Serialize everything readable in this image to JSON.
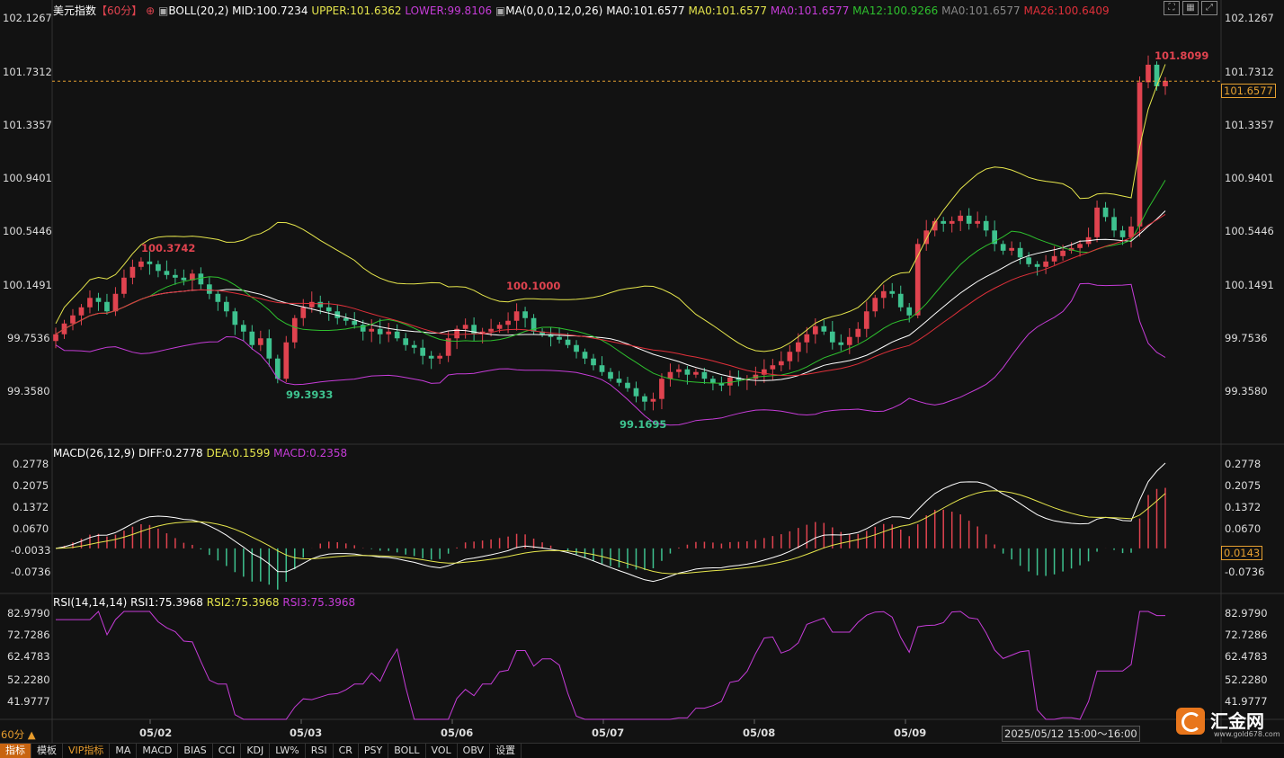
{
  "title": "美元指数",
  "period": "【60分】",
  "boll": {
    "name": "BOLL(20,2)",
    "mid": "MID:100.7234",
    "upper": "UPPER:101.6362",
    "lower": "LOWER:99.8106"
  },
  "ma": {
    "name": "MA(0,0,0,12,0,26)",
    "items": [
      "MA0:101.6577",
      "MA0:101.6577",
      "MA0:101.6577",
      "MA12:100.9266",
      "MA0:101.6577",
      "MA26:100.6409"
    ]
  },
  "main_ticks": [
    "102.1267",
    "101.7312",
    "101.3357",
    "100.9401",
    "100.5446",
    "100.1491",
    "99.7536",
    "99.3580"
  ],
  "last_price": "101.6577",
  "annotations": {
    "max": "101.8099",
    "min1": "99.3933",
    "min2": "99.1695",
    "high1": "100.3742",
    "high2": "100.1000"
  },
  "macd": {
    "name": "MACD(26,12,9)",
    "diff": "DIFF:0.2778",
    "dea": "DEA:0.1599",
    "macd": "MACD:0.2358",
    "ticks": [
      "0.2778",
      "0.2075",
      "0.1372",
      "0.0670",
      "-0.0033",
      "-0.0736"
    ],
    "right_ticks": [
      "0.2778",
      "0.2075",
      "0.1372",
      "0.0670",
      "0.0143",
      "-0.0736"
    ]
  },
  "rsi": {
    "name": "RSI(14,14,14)",
    "rsi1": "RSI1:75.3968",
    "rsi2": "RSI2:75.3968",
    "rsi3": "RSI3:75.3968",
    "ticks": [
      "82.9790",
      "72.7286",
      "62.4783",
      "52.2280",
      "41.9777"
    ]
  },
  "dates": [
    "05/02",
    "05/03",
    "05/06",
    "05/07",
    "05/08",
    "05/09"
  ],
  "date_range": "2025/05/12 15:00～16:00",
  "period_bottom": "60分 ▲",
  "logo_text": "汇金网",
  "logo_url": "www.gold678.com",
  "toolbar": [
    "指标",
    "模板",
    "VIP指标",
    "MA",
    "MACD",
    "BIAS",
    "CCI",
    "KDJ",
    "LW%",
    "RSI",
    "CR",
    "PSY",
    "BOLL",
    "VOL",
    "OBV",
    "设置"
  ],
  "colors": {
    "up": "#e0434f",
    "down": "#3ec28f",
    "upper": "#e6e64c",
    "lower": "#c63cd8",
    "mid": "#ffffff",
    "ma12": "#2ec02e",
    "ma26": "#e0303a",
    "rsi": "#c63cd8"
  },
  "chart_data": {
    "type": "candlestick",
    "note_series": [
      "close"
    ],
    "close": [
      99.78,
      99.86,
      99.92,
      99.98,
      100.05,
      100.02,
      99.95,
      100.08,
      100.2,
      100.28,
      100.32,
      100.3,
      100.25,
      100.22,
      100.2,
      100.18,
      100.23,
      100.15,
      100.08,
      100.02,
      99.95,
      99.85,
      99.8,
      99.7,
      99.75,
      99.6,
      99.45,
      99.72,
      99.9,
      99.98,
      100.02,
      99.98,
      99.95,
      99.9,
      99.88,
      99.85,
      99.8,
      99.82,
      99.78,
      99.8,
      99.75,
      99.7,
      99.68,
      99.62,
      99.6,
      99.62,
      99.75,
      99.82,
      99.85,
      99.78,
      99.8,
      99.82,
      99.85,
      99.88,
      99.95,
      99.9,
      99.8,
      99.78,
      99.76,
      99.74,
      99.7,
      99.65,
      99.6,
      99.55,
      99.5,
      99.45,
      99.42,
      99.38,
      99.32,
      99.28,
      99.3,
      99.45,
      99.5,
      99.52,
      99.48,
      99.5,
      99.45,
      99.42,
      99.4,
      99.46,
      99.44,
      99.45,
      99.48,
      99.52,
      99.55,
      99.58,
      99.65,
      99.72,
      99.78,
      99.84,
      99.8,
      99.72,
      99.7,
      99.76,
      99.82,
      99.95,
      100.05,
      100.1,
      100.08,
      99.98,
      99.92,
      100.45,
      100.55,
      100.62,
      100.6,
      100.62,
      100.66,
      100.6,
      100.62,
      100.55,
      100.45,
      100.4,
      100.42,
      100.35,
      100.3,
      100.28,
      100.32,
      100.36,
      100.4,
      100.42,
      100.45,
      100.5,
      100.72,
      100.65,
      100.55,
      100.5,
      100.58,
      101.65,
      101.78,
      101.62,
      101.66
    ]
  }
}
